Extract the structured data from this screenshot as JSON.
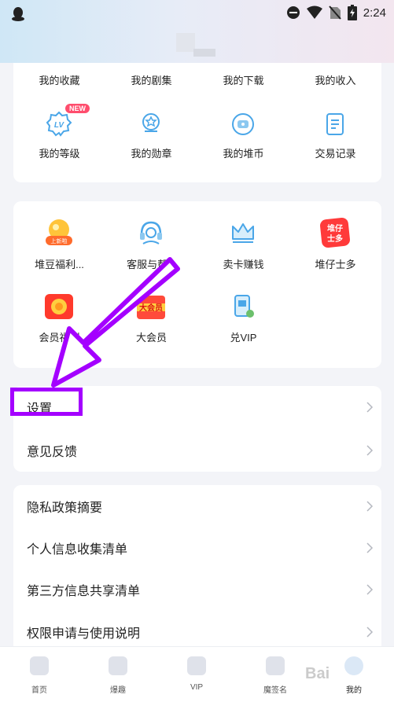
{
  "status_bar": {
    "time": "2:24"
  },
  "top_grid": {
    "row1": [
      {
        "label": "我的收藏"
      },
      {
        "label": "我的剧集"
      },
      {
        "label": "我的下载"
      },
      {
        "label": "我的收入"
      }
    ],
    "row2": [
      {
        "label": "我的等级",
        "badge": "NEW",
        "icon": "level-icon"
      },
      {
        "label": "我的勋章",
        "icon": "medal-icon"
      },
      {
        "label": "我的堆币",
        "icon": "coin-icon"
      },
      {
        "label": "交易记录",
        "icon": "record-icon"
      }
    ]
  },
  "services": {
    "row1": [
      {
        "label": "堆豆福利...",
        "icon": "bean-gift-icon",
        "tag": "上新啦"
      },
      {
        "label": "客服与帮...",
        "icon": "customer-service-icon"
      },
      {
        "label": "卖卡赚钱",
        "icon": "crown-icon"
      },
      {
        "label": "堆仔士多",
        "icon": "store-icon",
        "tag": "堆仔士多"
      }
    ],
    "row2": [
      {
        "label": "会员福利",
        "icon": "member-gift-icon"
      },
      {
        "label": "大会员",
        "icon": "big-member-icon",
        "tag": "大会员"
      },
      {
        "label": "兑VIP",
        "icon": "redeem-vip-icon"
      }
    ]
  },
  "settings_list": [
    "设置",
    "意见反馈"
  ],
  "policy_list": [
    "隐私政策摘要",
    "个人信息收集清单",
    "第三方信息共享清单",
    "权限申请与使用说明"
  ],
  "bottom_nav": [
    "首页",
    "爆趣",
    "VIP",
    "魔签名",
    "我的"
  ],
  "colors": {
    "accent": "#a400ff",
    "badge": "#ff4d6d",
    "icon_blue": "#4aa6e8"
  },
  "watermark": "Bai"
}
